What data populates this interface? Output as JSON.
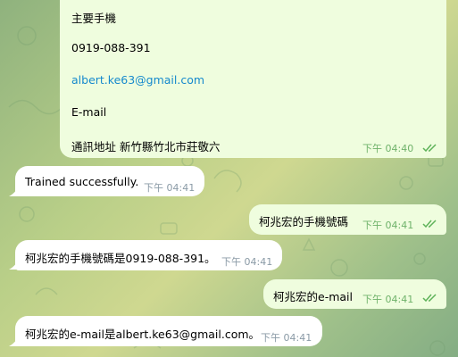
{
  "contact_card": {
    "lines": [
      "主要手機",
      "0919-088-391",
      "albert.ke63@gmail.com",
      "E-mail",
      "通訊地址 新竹縣竹北市莊敬六"
    ],
    "time": "下午 04:40"
  },
  "messages": [
    {
      "text": "Trained successfully.",
      "time": "下午 04:41"
    },
    {
      "text": "柯兆宏的手機號碼",
      "time": "下午 04:41"
    },
    {
      "text": "柯兆宏的手機號碼是0919-088-391。",
      "time": "下午 04:41"
    },
    {
      "text": "柯兆宏的e-mail",
      "time": "下午 04:41"
    },
    {
      "text": "柯兆宏的e-mail是albert.ke63@gmail.com。",
      "time": "下午 04:41"
    }
  ],
  "colors": {
    "incoming_bubble": "#ffffff",
    "outgoing_bubble": "#effdde",
    "link": "#168acd",
    "read_check": "#5fb35a"
  }
}
